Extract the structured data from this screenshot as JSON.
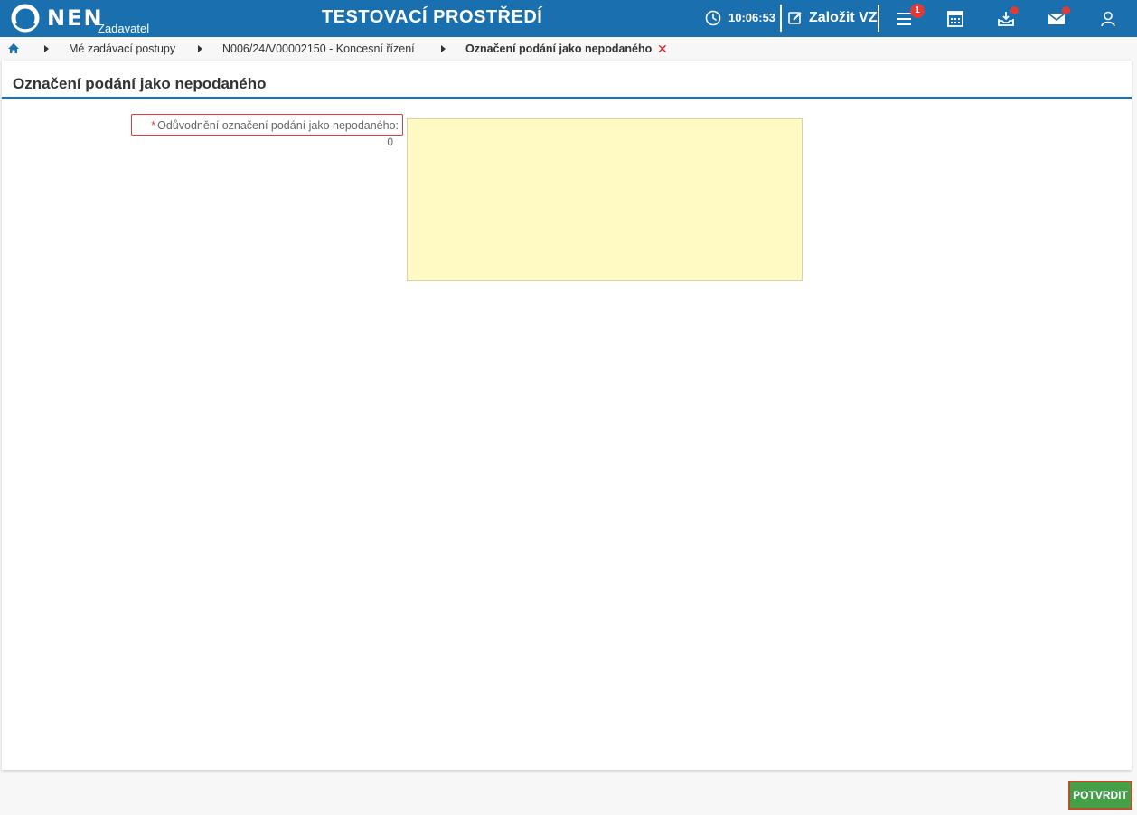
{
  "header": {
    "logo_text": "NEN",
    "logo_subtitle": "Zadavatel",
    "environment_title": "TESTOVACÍ PROSTŘEDÍ",
    "session_time": "10:06:53",
    "create_label": "Založit VZ",
    "tasks_badge": "1",
    "accent_color": "#1a6fae"
  },
  "breadcrumb": {
    "items": [
      "Mé zadávací postupy",
      "N006/24/V00002150 - Koncesní řízení"
    ],
    "current": "Označení podání jako nepodaného"
  },
  "page": {
    "title": "Označení podání jako nepodaného"
  },
  "form": {
    "required_marker": "*",
    "reason_label": "Odůvodnění označení podání jako nepodaného:",
    "reason_value": "",
    "char_count": "0"
  },
  "footer": {
    "confirm_label": "POTVRDIT"
  }
}
